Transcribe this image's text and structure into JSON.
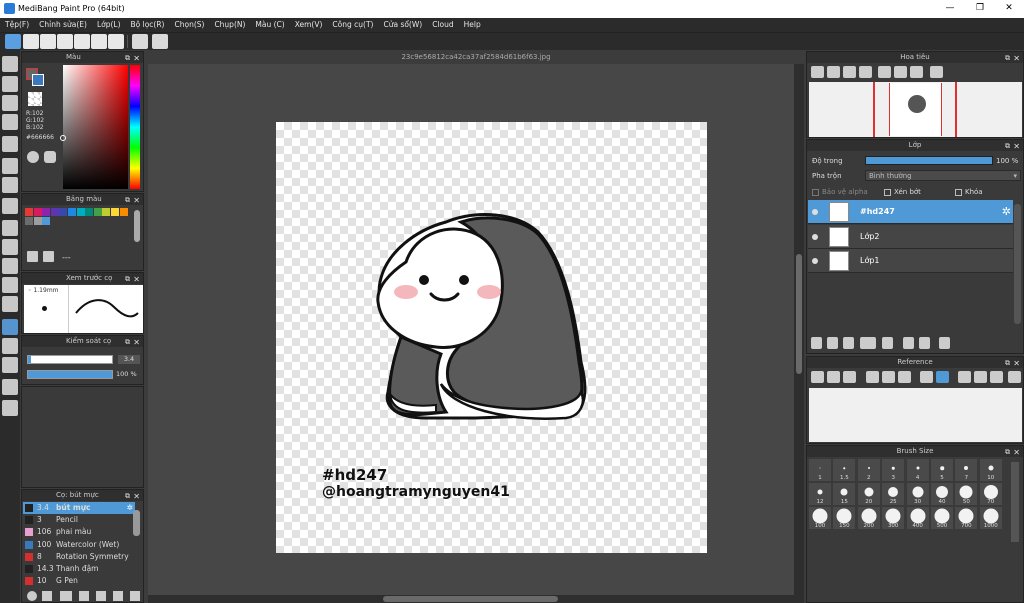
{
  "window": {
    "title": "MediBang Paint Pro (64bit)",
    "min": "—",
    "max": "❐",
    "close": "✕"
  },
  "menu": [
    "Tệp(F)",
    "Chỉnh sửa(E)",
    "Lớp(L)",
    "Bộ lọc(R)",
    "Chọn(S)",
    "Chụp(N)",
    "Màu (C)",
    "Xem(V)",
    "Công cụ(T)",
    "Cửa sổ(W)",
    "Cloud",
    "Help"
  ],
  "canvas": {
    "filename": "23c9e56812ca42ca37af2584d61b6f63.jpg",
    "hashtag": "#hd247",
    "handle": "@hoangtramynguyen41"
  },
  "color_panel": {
    "title": "Màu",
    "rgb_r": "R:102",
    "rgb_g": "G:102",
    "rgb_b": "B:102",
    "hex": "#666666"
  },
  "palette_panel": {
    "title": "Bảng màu",
    "footer": "---",
    "swatches": [
      "#e53935",
      "#d81b60",
      "#8e24aa",
      "#5e35b1",
      "#3949ab",
      "#1e88e5",
      "#00acc1",
      "#00897b",
      "#43a047",
      "#c0ca33",
      "#fdd835",
      "#fb8c00",
      "#6d6d6d",
      "#9e9e9e",
      "#4f9ad6"
    ]
  },
  "brush_preview": {
    "title": "Xem trước cọ",
    "size": "1.19mm"
  },
  "brush_control": {
    "title": "Kiểm soát cọ",
    "size_value": "3.4",
    "opacity_value": "100 %",
    "size_fill": 0.03,
    "opacity_fill": 1.0
  },
  "brush_list": {
    "title": "Cọ: bút mực",
    "items": [
      {
        "num": "3.4",
        "name": "bút mực",
        "color": "#222222",
        "selected": true
      },
      {
        "num": "3",
        "name": "Pencil",
        "color": "#222222"
      },
      {
        "num": "106",
        "name": "phai màu",
        "color": "#e8a0d0"
      },
      {
        "num": "100",
        "name": "Watercolor (Wet)",
        "color": "#3a78c0"
      },
      {
        "num": "8",
        "name": "Rotation Symmetry Pe",
        "color": "#d32f2f"
      },
      {
        "num": "14.3",
        "name": "Thanh đậm",
        "color": "#222222"
      },
      {
        "num": "10",
        "name": "G Pen",
        "color": "#d32f2f"
      }
    ]
  },
  "navigator": {
    "title": "Hoa tiêu"
  },
  "layer_panel": {
    "title": "Lớp",
    "opacity_label": "Độ trong",
    "opacity_value": "100 %",
    "opacity_fill": 1.0,
    "blend_label": "Pha trộn",
    "blend_value": "Bình thường",
    "protect_alpha": "Bảo vệ alpha",
    "clip": "Xén bớt",
    "lock": "Khóa",
    "layers": [
      {
        "name": "#hd247",
        "selected": true
      },
      {
        "name": "Lớp2",
        "selected": false
      },
      {
        "name": "Lớp1",
        "selected": false
      }
    ]
  },
  "reference_panel": {
    "title": "Reference"
  },
  "brush_size_panel": {
    "title": "Brush Size",
    "sizes": [
      "1",
      "1.5",
      "2",
      "3",
      "4",
      "5",
      "7",
      "10",
      "12",
      "15",
      "20",
      "25",
      "30",
      "40",
      "50",
      "70",
      "100",
      "150",
      "200",
      "300",
      "400",
      "500",
      "700",
      "1000"
    ]
  }
}
